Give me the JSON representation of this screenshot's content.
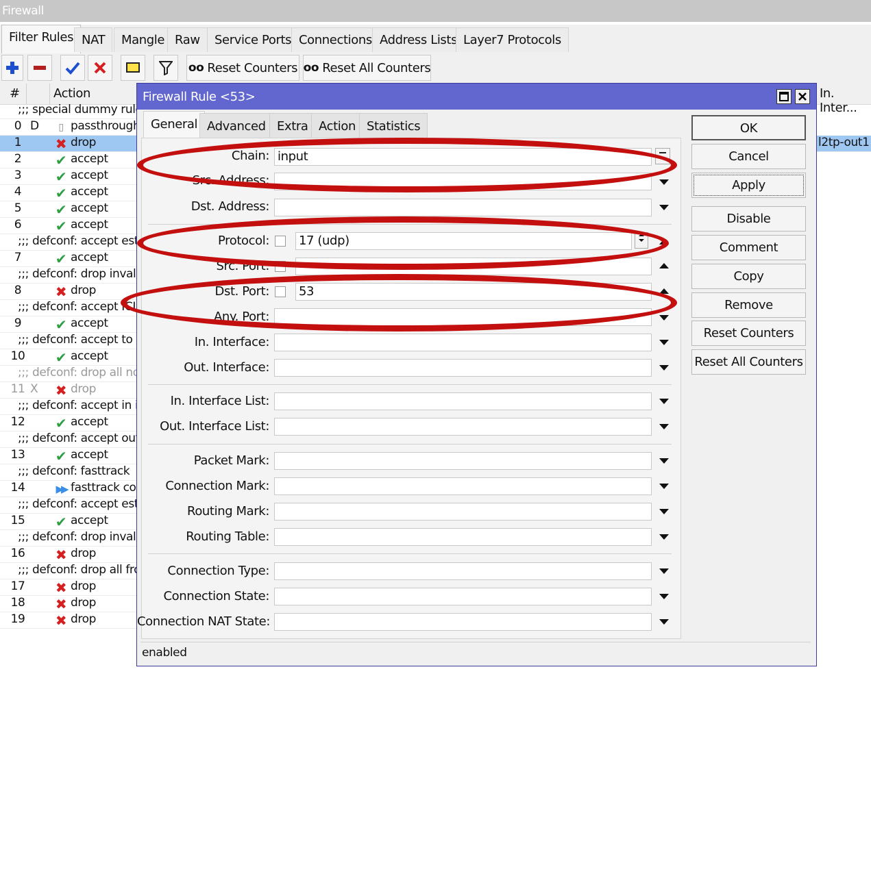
{
  "window": {
    "title": "Firewall"
  },
  "tabs": [
    "Filter Rules",
    "NAT",
    "Mangle",
    "Raw",
    "Service Ports",
    "Connections",
    "Address Lists",
    "Layer7 Protocols"
  ],
  "toolbar": {
    "add_icon": "plus-icon",
    "remove_icon": "minus-icon",
    "enable_icon": "check-icon",
    "disable_icon": "x-icon",
    "comment_icon": "note-icon",
    "filter_icon": "funnel-icon",
    "reset_counters": "Reset Counters",
    "reset_all_counters": "Reset All Counters",
    "counter_glyph": "oo"
  },
  "list": {
    "headers": {
      "num": "#",
      "action": "Action",
      "in_interface": "In. Inter..."
    },
    "selected_extra": "l2tp-out1",
    "rows": [
      {
        "type": "comment",
        "text": ";;; special dummy rule t"
      },
      {
        "type": "rule",
        "num": "0",
        "flag": "D",
        "icon": "passthrough",
        "action": "passthrough"
      },
      {
        "type": "rule",
        "num": "1",
        "flag": "",
        "icon": "drop",
        "action": "drop",
        "selected": true
      },
      {
        "type": "rule",
        "num": "2",
        "flag": "",
        "icon": "accept",
        "action": "accept"
      },
      {
        "type": "rule",
        "num": "3",
        "flag": "",
        "icon": "accept",
        "action": "accept"
      },
      {
        "type": "rule",
        "num": "4",
        "flag": "",
        "icon": "accept",
        "action": "accept"
      },
      {
        "type": "rule",
        "num": "5",
        "flag": "",
        "icon": "accept",
        "action": "accept"
      },
      {
        "type": "rule",
        "num": "6",
        "flag": "",
        "icon": "accept",
        "action": "accept"
      },
      {
        "type": "comment",
        "text": ";;; defconf: accept esta"
      },
      {
        "type": "rule",
        "num": "7",
        "flag": "",
        "icon": "accept",
        "action": "accept"
      },
      {
        "type": "comment",
        "text": ";;; defconf: drop invalid"
      },
      {
        "type": "rule",
        "num": "8",
        "flag": "",
        "icon": "drop",
        "action": "drop"
      },
      {
        "type": "comment",
        "text": ";;; defconf: accept ICI"
      },
      {
        "type": "rule",
        "num": "9",
        "flag": "",
        "icon": "accept",
        "action": "accept"
      },
      {
        "type": "comment",
        "text": ";;; defconf: accept to lo"
      },
      {
        "type": "rule",
        "num": "10",
        "flag": "",
        "icon": "accept",
        "action": "accept"
      },
      {
        "type": "comment",
        "text": ";;; defconf: drop all not",
        "disabled": true
      },
      {
        "type": "rule",
        "num": "11",
        "flag": "X",
        "icon": "drop",
        "action": "drop",
        "disabled": true
      },
      {
        "type": "comment",
        "text": ";;; defconf: accept in ip"
      },
      {
        "type": "rule",
        "num": "12",
        "flag": "",
        "icon": "accept",
        "action": "accept"
      },
      {
        "type": "comment",
        "text": ";;; defconf: accept out"
      },
      {
        "type": "rule",
        "num": "13",
        "flag": "",
        "icon": "accept",
        "action": "accept"
      },
      {
        "type": "comment",
        "text": ";;; defconf: fasttrack"
      },
      {
        "type": "rule",
        "num": "14",
        "flag": "",
        "icon": "fasttrack",
        "action": "fasttrack cor"
      },
      {
        "type": "comment",
        "text": ";;; defconf: accept esta"
      },
      {
        "type": "rule",
        "num": "15",
        "flag": "",
        "icon": "accept",
        "action": "accept"
      },
      {
        "type": "comment",
        "text": ";;; defconf: drop invalid"
      },
      {
        "type": "rule",
        "num": "16",
        "flag": "",
        "icon": "drop",
        "action": "drop"
      },
      {
        "type": "comment",
        "text": ";;; defconf: drop all fron"
      },
      {
        "type": "rule",
        "num": "17",
        "flag": "",
        "icon": "drop",
        "action": "drop"
      },
      {
        "type": "rule",
        "num": "18",
        "flag": "",
        "icon": "drop",
        "action": "drop"
      },
      {
        "type": "rule",
        "num": "19",
        "flag": "",
        "icon": "drop",
        "action": "drop"
      }
    ]
  },
  "dialog": {
    "title": "Firewall Rule <53>",
    "tabs": [
      "General",
      "Advanced",
      "Extra",
      "Action",
      "Statistics"
    ],
    "fields": {
      "chain": {
        "label": "Chain:",
        "value": "input"
      },
      "src_address": {
        "label": "Src. Address:",
        "value": ""
      },
      "dst_address": {
        "label": "Dst. Address:",
        "value": ""
      },
      "protocol": {
        "label": "Protocol:",
        "value": "17 (udp)"
      },
      "src_port": {
        "label": "Src. Port:",
        "value": ""
      },
      "dst_port": {
        "label": "Dst. Port:",
        "value": "53"
      },
      "any_port": {
        "label": "Any. Port:",
        "value": ""
      },
      "in_interface": {
        "label": "In. Interface:",
        "value": ""
      },
      "out_interface": {
        "label": "Out. Interface:",
        "value": ""
      },
      "in_interface_list": {
        "label": "In. Interface List:",
        "value": ""
      },
      "out_interface_list": {
        "label": "Out. Interface List:",
        "value": ""
      },
      "packet_mark": {
        "label": "Packet Mark:",
        "value": ""
      },
      "connection_mark": {
        "label": "Connection Mark:",
        "value": ""
      },
      "routing_mark": {
        "label": "Routing Mark:",
        "value": ""
      },
      "routing_table": {
        "label": "Routing Table:",
        "value": ""
      },
      "connection_type": {
        "label": "Connection Type:",
        "value": ""
      },
      "connection_state": {
        "label": "Connection State:",
        "value": ""
      },
      "connection_nat_state": {
        "label": "Connection NAT State:",
        "value": ""
      }
    },
    "buttons": [
      "OK",
      "Cancel",
      "Apply",
      "Disable",
      "Comment",
      "Copy",
      "Remove",
      "Reset Counters",
      "Reset All Counters"
    ],
    "status": "enabled"
  },
  "colors": {
    "title_bar": "#6267cf",
    "selection": "#9ec7f2",
    "highlight_ellipse": "#c40f0f",
    "accept": "#2ea043",
    "drop": "#d42020"
  }
}
